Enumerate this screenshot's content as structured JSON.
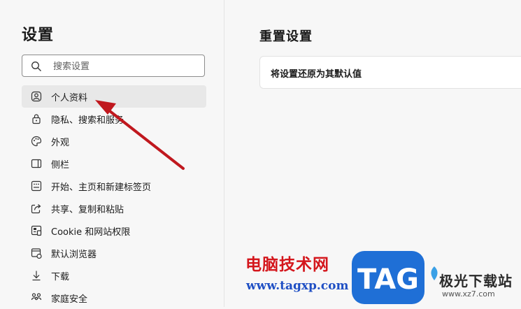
{
  "sidebar": {
    "title": "设置",
    "search": {
      "placeholder": "搜索设置",
      "value": ""
    },
    "items": [
      {
        "label": "个人资料",
        "icon": "profile-icon",
        "active": true
      },
      {
        "label": "隐私、搜索和服务",
        "icon": "lock-icon"
      },
      {
        "label": "外观",
        "icon": "palette-icon"
      },
      {
        "label": "侧栏",
        "icon": "sidebar-icon"
      },
      {
        "label": "开始、主页和新建标签页",
        "icon": "home-grid-icon"
      },
      {
        "label": "共享、复制和粘贴",
        "icon": "share-icon"
      },
      {
        "label": "Cookie 和网站权限",
        "icon": "cookie-icon"
      },
      {
        "label": "默认浏览器",
        "icon": "browser-icon"
      },
      {
        "label": "下载",
        "icon": "download-icon"
      },
      {
        "label": "家庭安全",
        "icon": "family-icon"
      }
    ]
  },
  "main": {
    "title": "重置设置",
    "reset_item": "将设置还原为其默认值"
  },
  "watermark": {
    "site_name": "电脑技术网",
    "site_url": "www.tagxp.com",
    "logo_text": "TAG",
    "partner_name": "极光下载站",
    "partner_url": "www.xz7.com"
  },
  "colors": {
    "accent_blue": "#1f6fd6",
    "arrow_red": "#c0181e",
    "watermark_red": "#d4161c"
  }
}
